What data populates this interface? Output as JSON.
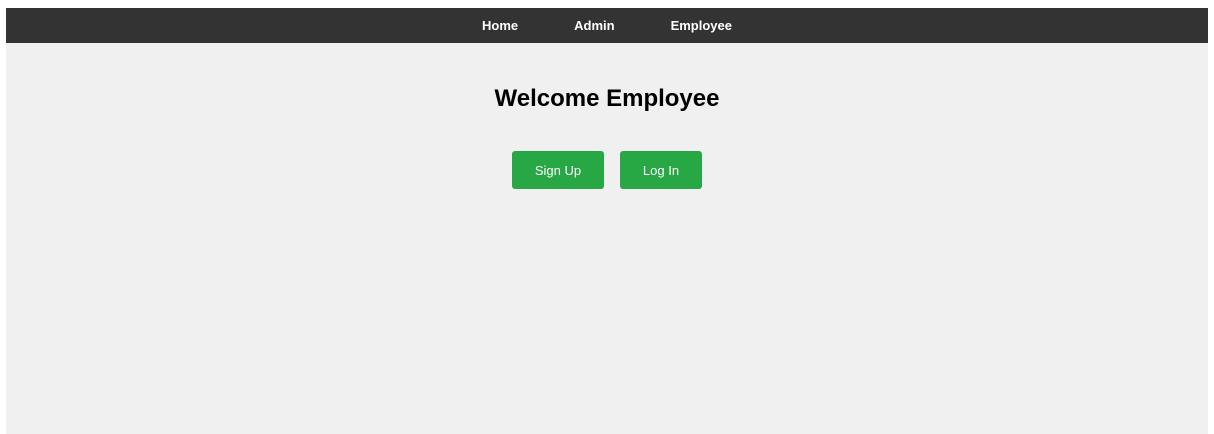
{
  "nav": {
    "items": [
      {
        "label": "Home"
      },
      {
        "label": "Admin"
      },
      {
        "label": "Employee"
      }
    ]
  },
  "main": {
    "title": "Welcome Employee",
    "signup_label": "Sign Up",
    "login_label": "Log In"
  },
  "colors": {
    "navbar": "#333333",
    "background": "#f0f0f0",
    "button": "#28a745"
  }
}
